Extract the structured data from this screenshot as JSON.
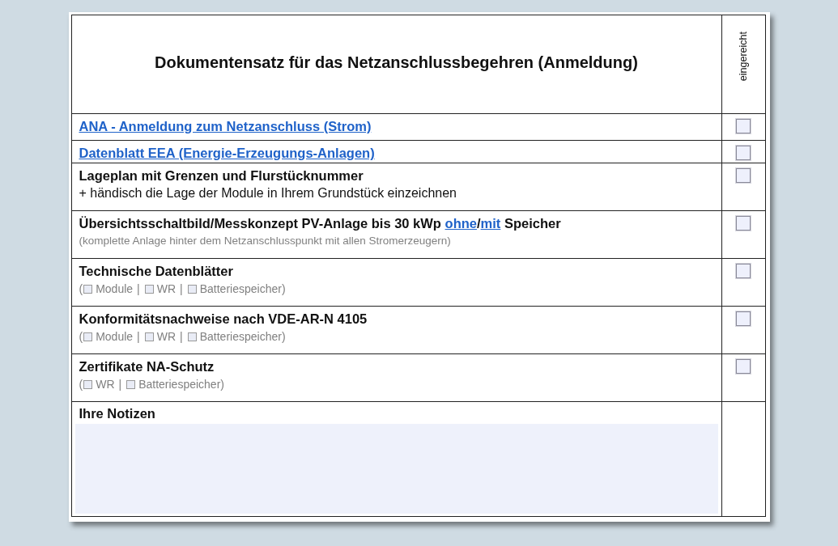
{
  "title": "Dokumentensatz für das Netzanschlussbegehren (Anmeldung)",
  "column_header": "eingereicht",
  "rows": [
    {
      "kind": "item",
      "segments": [
        {
          "text": "ANA - Anmeldung zum Netzanschluss (Strom)",
          "link": true
        }
      ],
      "submitted": false
    },
    {
      "kind": "item",
      "segments": [
        {
          "text": "Datenblatt EEA (Energie-Erzeugungs-Anlagen)",
          "link": true
        }
      ],
      "submitted": false
    },
    {
      "kind": "item",
      "segments": [
        {
          "text": "Lageplan mit Grenzen und Flurstücknummer",
          "link": false
        }
      ],
      "note": "+ händisch die Lage der Module in Ihrem Grundstück einzeichnen",
      "note_muted": false,
      "submitted": false
    },
    {
      "kind": "item",
      "segments": [
        {
          "text": "Übersichtsschaltbild/Messkonzept PV-Anlage bis 30 kWp",
          "link": false
        },
        {
          "text": "ohne",
          "link": true
        },
        {
          "text": "/",
          "link": false
        },
        {
          "text": "mit",
          "link": true
        },
        {
          "text": "Speicher",
          "link": false
        }
      ],
      "note": "(komplette Anlage hinter dem Netzanschlusspunkt mit allen Stromerzeugern)",
      "note_muted": true,
      "submitted": false
    },
    {
      "kind": "item",
      "segments": [
        {
          "text": "Technische Datenblätter",
          "link": false
        }
      ],
      "options": {
        "open": "(",
        "separator": "|",
        "close": ")",
        "items": [
          {
            "label": "Module",
            "checked": false
          },
          {
            "label": "WR",
            "checked": false
          },
          {
            "label": "Batteriespeicher",
            "checked": false
          }
        ]
      },
      "submitted": false
    },
    {
      "kind": "item",
      "segments": [
        {
          "text": "Konformitätsnachweise nach VDE-AR-N 4105",
          "link": false
        }
      ],
      "options": {
        "open": "(",
        "separator": "|",
        "close": ")",
        "items": [
          {
            "label": "Module",
            "checked": false
          },
          {
            "label": "WR",
            "checked": false
          },
          {
            "label": "Batteriespeicher",
            "checked": false
          }
        ]
      },
      "submitted": false
    },
    {
      "kind": "item",
      "segments": [
        {
          "text": "Zertifikate NA-Schutz",
          "link": false
        }
      ],
      "options": {
        "open": "(",
        "separator": "|",
        "close": ")",
        "items": [
          {
            "label": "WR",
            "checked": false
          },
          {
            "label": "Batteriespeicher",
            "checked": false
          }
        ]
      },
      "submitted": false
    },
    {
      "kind": "notes",
      "label": "Ihre Notizen"
    }
  ]
}
